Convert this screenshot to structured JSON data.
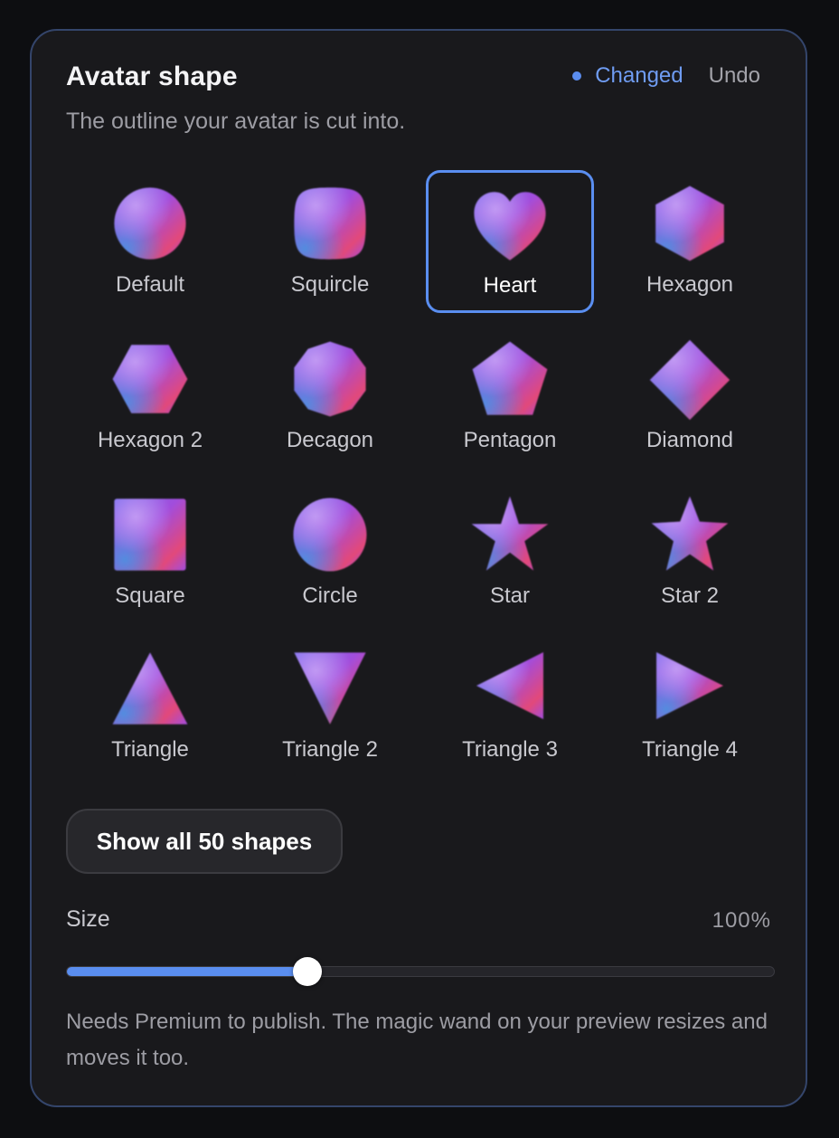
{
  "panel": {
    "title": "Avatar shape",
    "status_label": "Changed",
    "undo_label": "Undo",
    "subtitle": "The outline your avatar is cut into."
  },
  "shapes": [
    {
      "label": "Default",
      "icon": "rounded-blob-icon",
      "selected": false
    },
    {
      "label": "Squircle",
      "icon": "squircle-icon",
      "selected": false
    },
    {
      "label": "Heart",
      "icon": "heart-icon",
      "selected": true
    },
    {
      "label": "Hexagon",
      "icon": "hexagon-icon",
      "selected": false
    },
    {
      "label": "Hexagon 2",
      "icon": "hexagon-2-icon",
      "selected": false
    },
    {
      "label": "Decagon",
      "icon": "decagon-icon",
      "selected": false
    },
    {
      "label": "Pentagon",
      "icon": "pentagon-icon",
      "selected": false
    },
    {
      "label": "Diamond",
      "icon": "diamond-icon",
      "selected": false
    },
    {
      "label": "Square",
      "icon": "square-icon",
      "selected": false
    },
    {
      "label": "Circle",
      "icon": "circle-icon",
      "selected": false
    },
    {
      "label": "Star",
      "icon": "star-icon",
      "selected": false
    },
    {
      "label": "Star 2",
      "icon": "star-2-icon",
      "selected": false
    },
    {
      "label": "Triangle",
      "icon": "triangle-icon",
      "selected": false
    },
    {
      "label": "Triangle 2",
      "icon": "triangle-2-icon",
      "selected": false
    },
    {
      "label": "Triangle 3",
      "icon": "triangle-3-icon",
      "selected": false
    },
    {
      "label": "Triangle 4",
      "icon": "triangle-4-icon",
      "selected": false
    }
  ],
  "show_all_label": "Show all 50 shapes",
  "size": {
    "label": "Size",
    "value_text": "100%",
    "slider_fraction": 0.34
  },
  "footnote": "Needs Premium to publish. The magic wand on your preview resizes and moves it too.",
  "colors": {
    "accent": "#5a8ef0",
    "gradient": [
      "#7b6ff0",
      "#a24ddc",
      "#e2487a",
      "#4f8fe0"
    ]
  }
}
